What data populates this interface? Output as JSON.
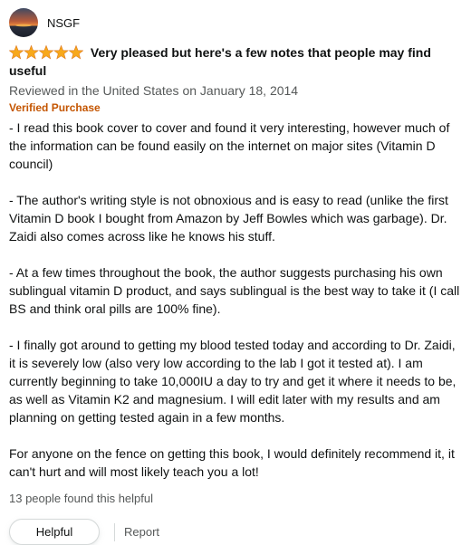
{
  "reviewer": {
    "name": "NSGF",
    "avatar_icon": "sunset-avatar-icon"
  },
  "review": {
    "rating": 5,
    "star_color": "#f7a81b",
    "title": "Very pleased but here's a few notes that people may find useful",
    "date_line": "Reviewed in the United States on January 18, 2014",
    "verified_label": "Verified Purchase",
    "paragraphs": [
      "- I read this book cover to cover and found it very interesting, however much of the information can be found easily on the internet on major sites (Vitamin D council)",
      "- The author's writing style is not obnoxious and is easy to read (unlike the first Vitamin D book I bought from Amazon by Jeff Bowles which was garbage). Dr. Zaidi also comes across like he knows his stuff.",
      "- At a few times throughout the book, the author suggests purchasing his own sublingual vitamin D product, and says sublingual is the best way to take it (I call BS and think oral pills are 100% fine).",
      "- I finally got around to getting my blood tested today and according to Dr. Zaidi, it is severely low (also very low according to the lab I got it tested at). I am currently beginning to take 10,000IU a day to try and get it where it needs to be, as well as Vitamin K2 and magnesium. I will edit later with my results and am planning on getting tested again in a few months.",
      "For anyone on the fence on getting this book, I would definitely recommend it, it can't hurt and will most likely teach you a lot!"
    ],
    "helpful_count": "13 people found this helpful"
  },
  "actions": {
    "helpful_label": "Helpful",
    "report_label": "Report"
  },
  "colors": {
    "verified": "#c45500",
    "secondary_text": "#565959"
  }
}
